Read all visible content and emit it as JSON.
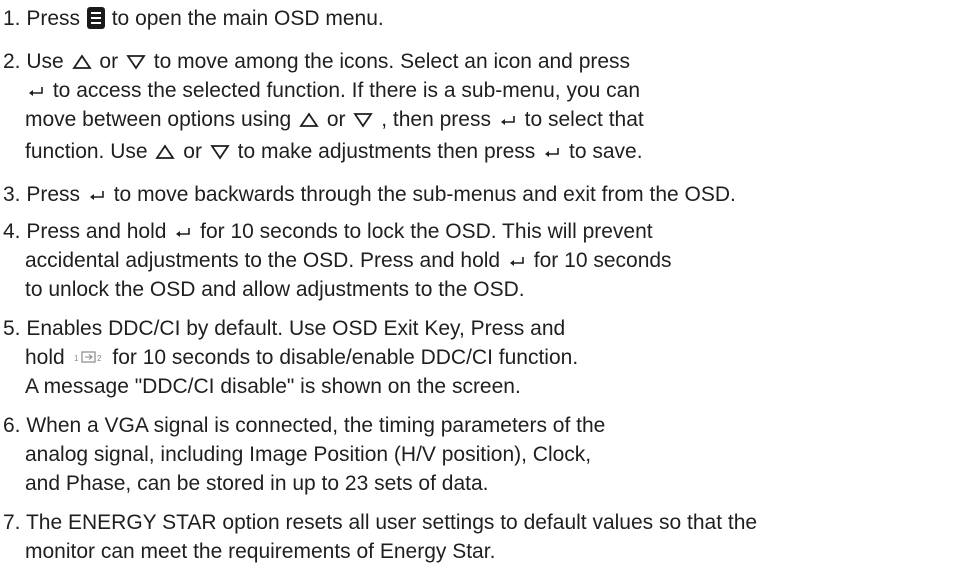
{
  "icons": {
    "menu": "menu-button-icon",
    "up": "up-triangle-icon",
    "down": "down-triangle-icon",
    "enter": "enter-return-icon",
    "source": "input-source-icon"
  },
  "item1": {
    "a": "1. Press",
    "b": "to open the main OSD menu."
  },
  "item2": {
    "l1a": "2. Use",
    "l1b": "or",
    "l1c": "to move among the icons. Select an icon and press",
    "l2": "to access the selected function. If there is a sub-menu, you can",
    "l3a": "move between options using",
    "l3b": "or",
    "l3c": ", then press",
    "l3d": "to select that",
    "l4a": "function. Use",
    "l4b": "or",
    "l4c": "to make adjustments then press",
    "l4d": "to save."
  },
  "item3": {
    "a": "3. Press",
    "b": "to move backwards through the sub-menus and exit from the OSD."
  },
  "item4": {
    "l1a": "4. Press and hold",
    "l1b": "for 10 seconds to lock the OSD. This will prevent",
    "l2a": "accidental adjustments to the OSD. Press and hold",
    "l2b": "for 10 seconds",
    "l3": "to unlock the OSD and allow adjustments to the OSD."
  },
  "item5": {
    "l1": "5. Enables DDC/CI by default. Use OSD Exit Key, Press and",
    "l2a": "hold",
    "l2b": "for 10 seconds to disable/enable DDC/CI function.",
    "l3": "A message \"DDC/CI disable\" is shown on the screen."
  },
  "item6": {
    "l1": "6. When a VGA signal is connected, the timing parameters of the",
    "l2": "analog signal, including Image Position (H/V position), Clock,",
    "l3": "and Phase, can be stored in up to 23 sets of data."
  },
  "item7": {
    "l1": "7. The ENERGY STAR option resets all user settings to default values so that the",
    "l2": "monitor can meet the requirements of Energy Star."
  }
}
